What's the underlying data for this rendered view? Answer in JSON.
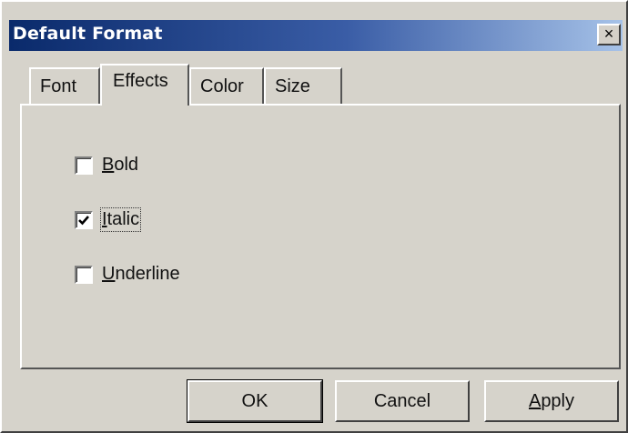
{
  "window": {
    "title": "Default Format",
    "close_glyph": "×"
  },
  "tabs": [
    {
      "label": "Font",
      "active": false
    },
    {
      "label": "Effects",
      "active": true
    },
    {
      "label": "Color",
      "active": false
    },
    {
      "label": "Size",
      "active": false
    }
  ],
  "effects": {
    "bold": {
      "mnemonic": "B",
      "rest": "old",
      "checked": false
    },
    "italic": {
      "mnemonic": "I",
      "rest": "talic",
      "checked": true
    },
    "underline": {
      "mnemonic": "U",
      "rest": "nderline",
      "checked": false
    }
  },
  "buttons": {
    "ok": "OK",
    "cancel": "Cancel",
    "apply_mnemonic": "A",
    "apply_rest": "pply"
  },
  "icons": {
    "close": "close-icon",
    "check": "checkmark-icon"
  }
}
